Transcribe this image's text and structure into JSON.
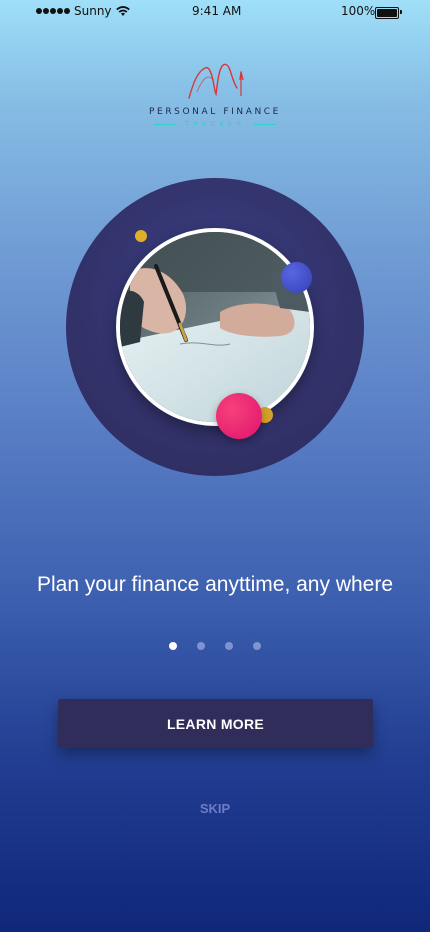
{
  "status_bar": {
    "carrier": "Sunny",
    "time": "9:41 AM",
    "battery_percent": "100%",
    "signal_bars": 5,
    "battery_level": 1.0,
    "icons": [
      "signal-dots-icon",
      "wifi-icon",
      "battery-icon"
    ]
  },
  "logo": {
    "title": "PERSONAL FINANCE",
    "subtitle": "TRACKER",
    "icon": "growth-arrow-logo-icon",
    "colors": {
      "mark": "#d7383b",
      "subtitle": "#2fd2c8"
    }
  },
  "hero": {
    "image": "hand-signing-document-photo",
    "colors": {
      "circle": "#313066",
      "pink_dot": "#e0136e",
      "blue_dot": "#3a46c4",
      "yellow_dot": "#e0b02a"
    }
  },
  "onboarding": {
    "tagline": "Plan your finance anyttime, any where",
    "page_count": 4,
    "current_page": 1
  },
  "actions": {
    "learn_more_label": "LEARN MORE",
    "skip_label": "SKIP"
  },
  "theme": {
    "gradient_top": "#9fdff8",
    "gradient_bottom": "#10277a",
    "button_bg": "#302d5b",
    "skip_color": "#6e7cc8"
  }
}
